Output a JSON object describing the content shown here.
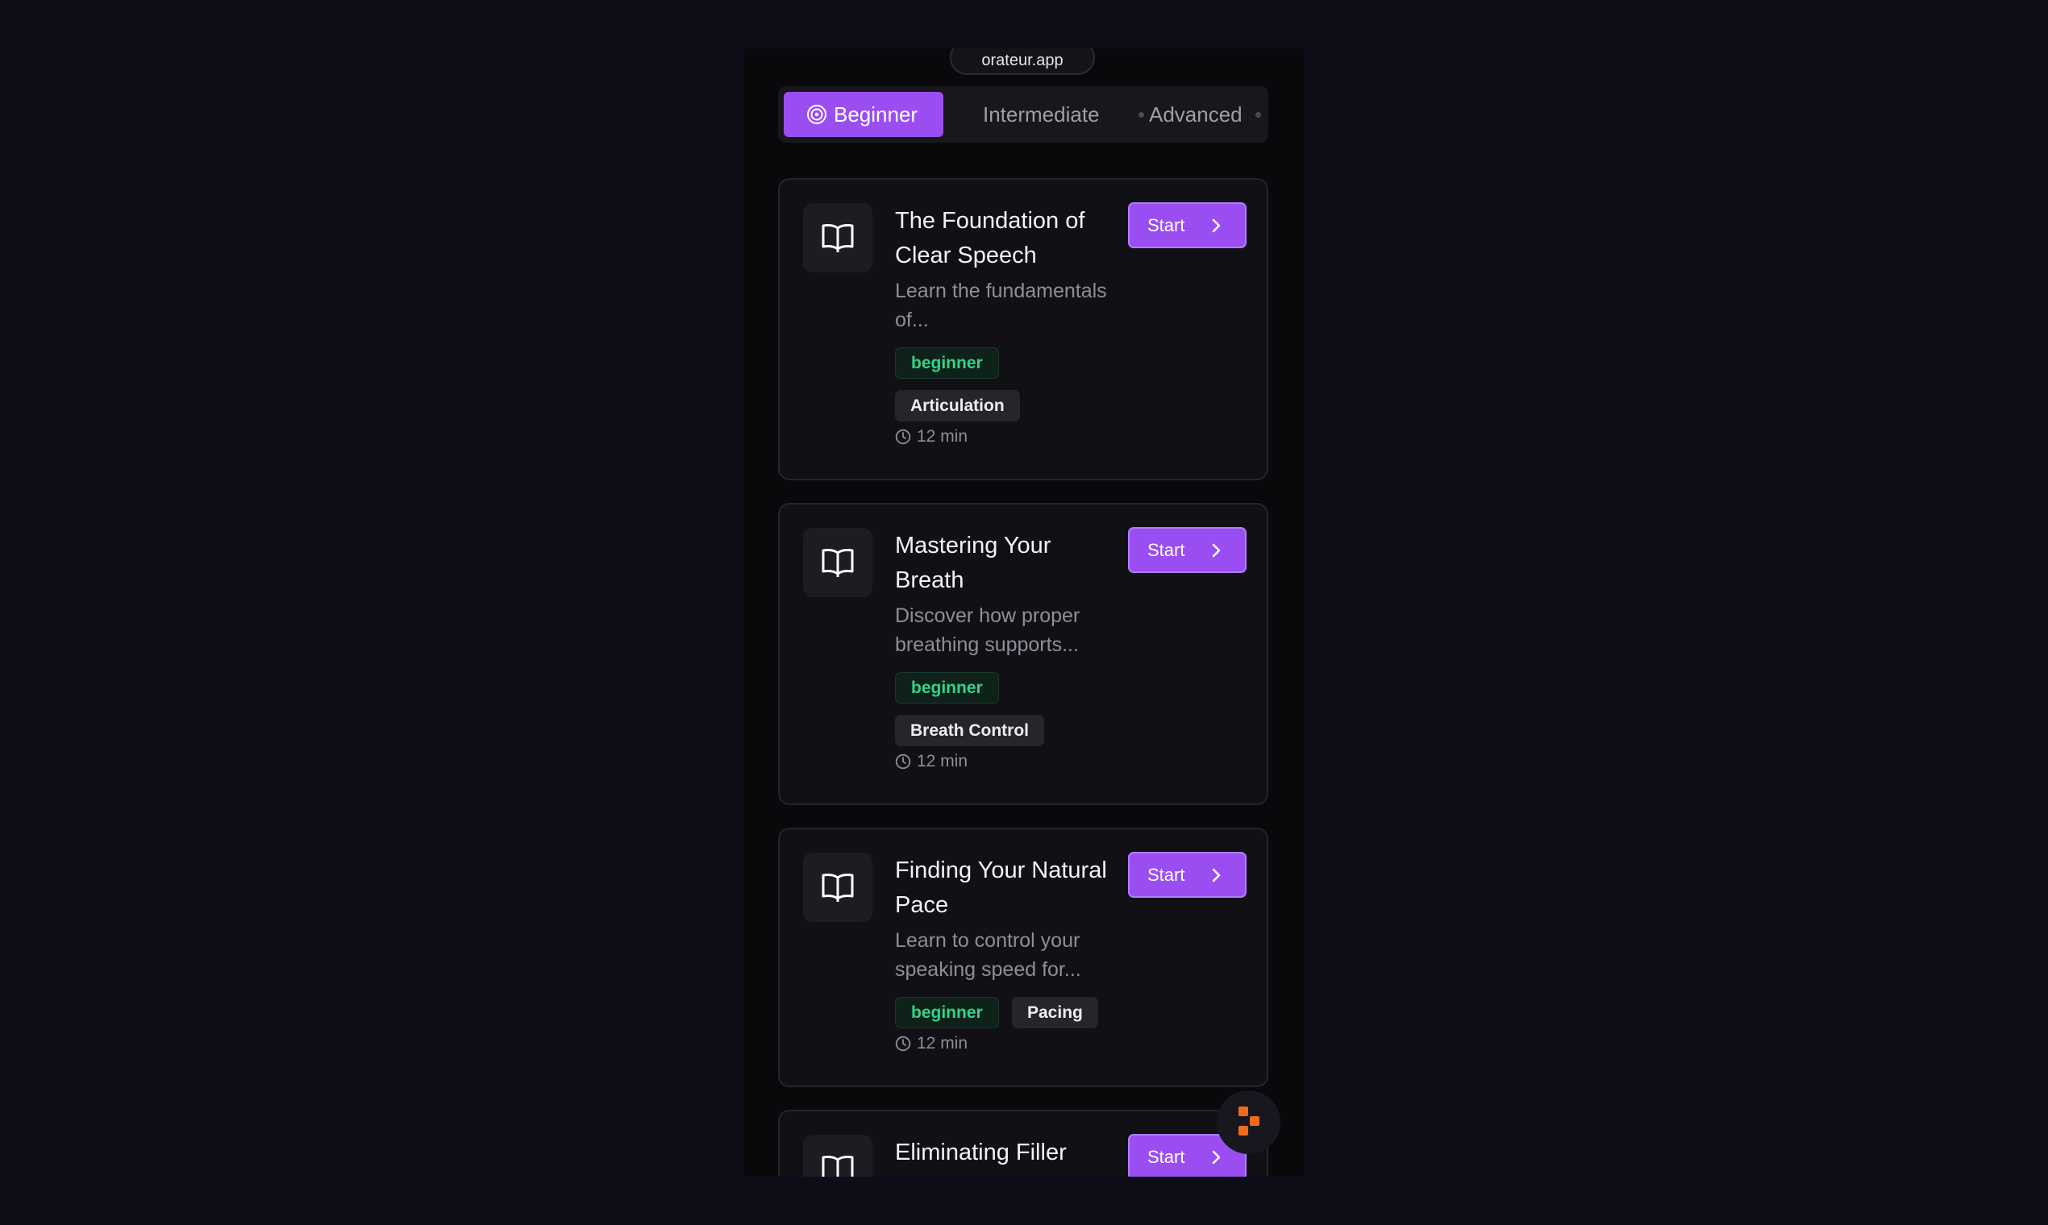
{
  "browser": {
    "url": "orateur.app"
  },
  "tabs": [
    {
      "label": "Beginner",
      "active": true,
      "icon": "target-icon"
    },
    {
      "label": "Intermediate",
      "active": false
    },
    {
      "label": "Advanced",
      "active": false
    }
  ],
  "lessons": [
    {
      "title": "The Foundation of Clear Speech",
      "description": "Learn the fundamentals of...",
      "level": "beginner",
      "topic": "Articulation",
      "duration": "12 min",
      "action": "Start",
      "icon": "book-open-icon"
    },
    {
      "title": "Mastering Your Breath",
      "description": "Discover how proper breathing supports...",
      "level": "beginner",
      "topic": "Breath Control",
      "duration": "12 min",
      "action": "Start",
      "icon": "book-open-icon"
    },
    {
      "title": "Finding Your Natural Pace",
      "description": "Learn to control your speaking speed for...",
      "level": "beginner",
      "topic": "Pacing",
      "duration": "12 min",
      "action": "Start",
      "icon": "book-open-icon"
    },
    {
      "title": "Eliminating Filler",
      "action": "Start",
      "icon": "book-open-icon"
    }
  ],
  "colors": {
    "accent": "#9a4ef1",
    "level_badge_text": "#33d28c",
    "fab_mark": "#f26a1b"
  }
}
